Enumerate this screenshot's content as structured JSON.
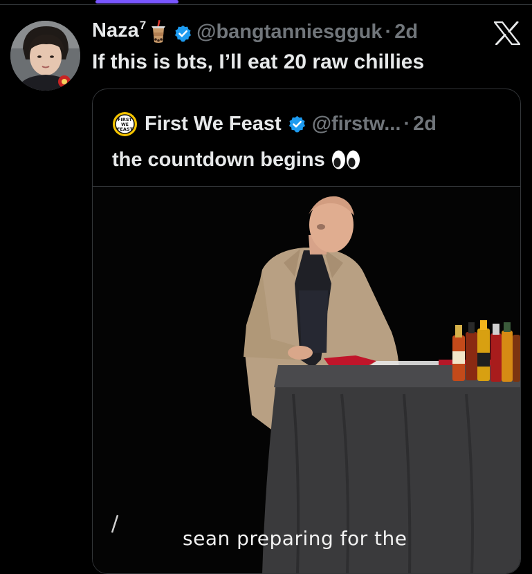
{
  "tweet": {
    "display_name": "Naza",
    "name_superscript": "7",
    "emoji": "bubble-tea-emoji",
    "handle": "@bangtanniesgguk",
    "separator": "·",
    "time": "2d",
    "text": "If this is bts, I’ll eat 20 raw chillies",
    "verified_color": "#1d9bf0"
  },
  "quoted_tweet": {
    "display_name": "First We Feast",
    "handle": "@firstw...",
    "separator": "·",
    "time": "2d",
    "text": "the countdown begins",
    "emoji": "eyes-emoji",
    "avatar_lettering": "FIRST WE FEAST",
    "media": {
      "caption": "sean preparing for the"
    }
  },
  "colors": {
    "background": "#000000",
    "text_primary": "#e7e9ea",
    "text_secondary": "#71767b",
    "border": "#333639",
    "accent_tab": "#7856ff"
  },
  "icons": {
    "platform_logo": "x-logo-icon",
    "verified": "verified-badge-icon"
  }
}
